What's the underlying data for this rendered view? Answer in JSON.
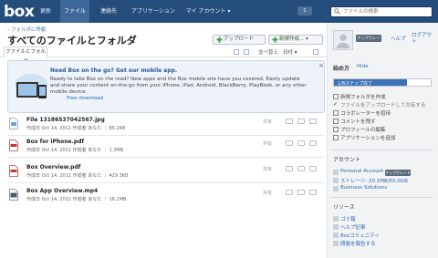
{
  "header": {
    "logo": "box",
    "nav": [
      "更新",
      "ファイル",
      "連絡先",
      "アプリケーション",
      "マイ アカウント ▾"
    ],
    "badge": "1",
    "search_placeholder": "ファイルの検索"
  },
  "main": {
    "breadcrumb": "‹ フォルダに移動",
    "title": "すべてのファイルとフォルダ",
    "upload_label": "アップロード",
    "new_label": "新規作成... ▾",
    "tab_label": "ファイルとフォルダ",
    "sort_label": "並べ替え:",
    "sort_value": "日付 ▾"
  },
  "banner": {
    "title": "Need Box on the go? Get our mobile app.",
    "text": "Ready to take Box on the road? New apps and the Box mobile site have you covered. Easily update and share your content on-the-go from your iPhone, iPad, Android, BlackBerry, PlayBook, or any other mobile device.",
    "link": "Free download",
    "close": "×"
  },
  "files": [
    {
      "name": "File 13186537042567.jpg",
      "meta": "作成日 Oct 14, 2011 作成者 あなた ｜ 85.2KB",
      "shared": "共有",
      "icon": "image-file-icon"
    },
    {
      "name": "Box for iPhone.pdf",
      "meta": "作成日 Oct 14, 2011 作成者 あなた ｜ 1.3MB",
      "shared": "共有",
      "icon": "pdf-file-icon"
    },
    {
      "name": "Box Overview.pdf",
      "meta": "作成日 Oct 14, 2011 作成者 あなた ｜ 429.3KB",
      "shared": "共有",
      "icon": "pdf-file-icon"
    },
    {
      "name": "Box App Overview.mp4",
      "meta": "作成日 Oct 14, 2011 作成者 あなた ｜ 18.1MB",
      "shared": "共有",
      "icon": "video-file-icon"
    }
  ],
  "sidebar": {
    "upgrade": "アップグレード",
    "help": "ヘルプ",
    "logout": "ログアウト",
    "gs_title": "始め方",
    "gs_hide": "Hide",
    "progress_label": "1/8ステップ完了",
    "progress_value": 0.125,
    "steps": [
      "新規フォルダを作成",
      "ファイルをアップロードして共有する",
      "コラボレーターを招待",
      "コメントを残す",
      "プロフィールの編集",
      "アプリケーションを追加"
    ],
    "account_title": "アカウント",
    "personal": "Personal Account",
    "plan_upgrade": "アップグレード",
    "storage": "ストレージ: 20.1MB/50.0GB",
    "business": "Business Solutions",
    "resources_title": "リソース",
    "resources": [
      "ゴミ箱",
      "ヘルプ記事",
      "Boxコミュニティ",
      "問題を報告する"
    ]
  },
  "colors": {
    "topbar": "#244d7c",
    "accent": "#3e72b8",
    "link": "#2a6bb5"
  }
}
